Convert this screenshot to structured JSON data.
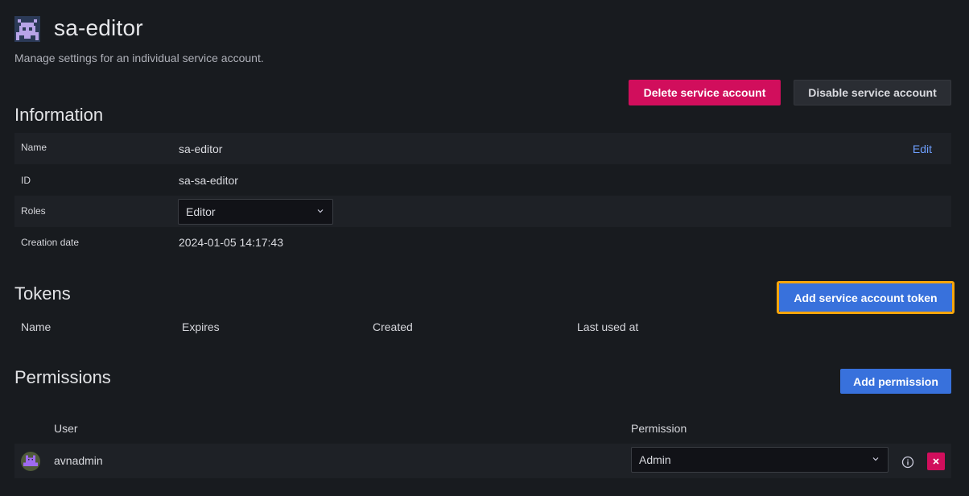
{
  "header": {
    "title": "sa-editor",
    "subtitle": "Manage settings for an individual service account."
  },
  "actions": {
    "delete_label": "Delete service account",
    "disable_label": "Disable service account"
  },
  "information": {
    "section_title": "Information",
    "edit_label": "Edit",
    "rows": [
      {
        "label": "Name",
        "value": "sa-editor"
      },
      {
        "label": "ID",
        "value": "sa-sa-editor"
      },
      {
        "label": "Roles",
        "value": "Editor"
      },
      {
        "label": "Creation date",
        "value": "2024-01-05 14:17:43"
      }
    ]
  },
  "tokens": {
    "section_title": "Tokens",
    "add_label": "Add service account token",
    "columns": [
      "Name",
      "Expires",
      "Created",
      "Last used at"
    ]
  },
  "permissions": {
    "section_title": "Permissions",
    "add_label": "Add permission",
    "columns": [
      "User",
      "Permission"
    ],
    "rows": [
      {
        "user": "avnadmin",
        "permission": "Admin"
      }
    ]
  },
  "colors": {
    "background": "#181b1f",
    "danger": "#d10e5c",
    "primary": "#3871dc",
    "highlight": "#f6a50c",
    "link": "#6e9fff"
  },
  "icons": {
    "header_avatar": "pixel-avatar-icon",
    "chevron": "chevron-down-icon",
    "info": "info-circle-icon",
    "delete": "close-icon",
    "user_avatar": "user-avatar-icon"
  }
}
